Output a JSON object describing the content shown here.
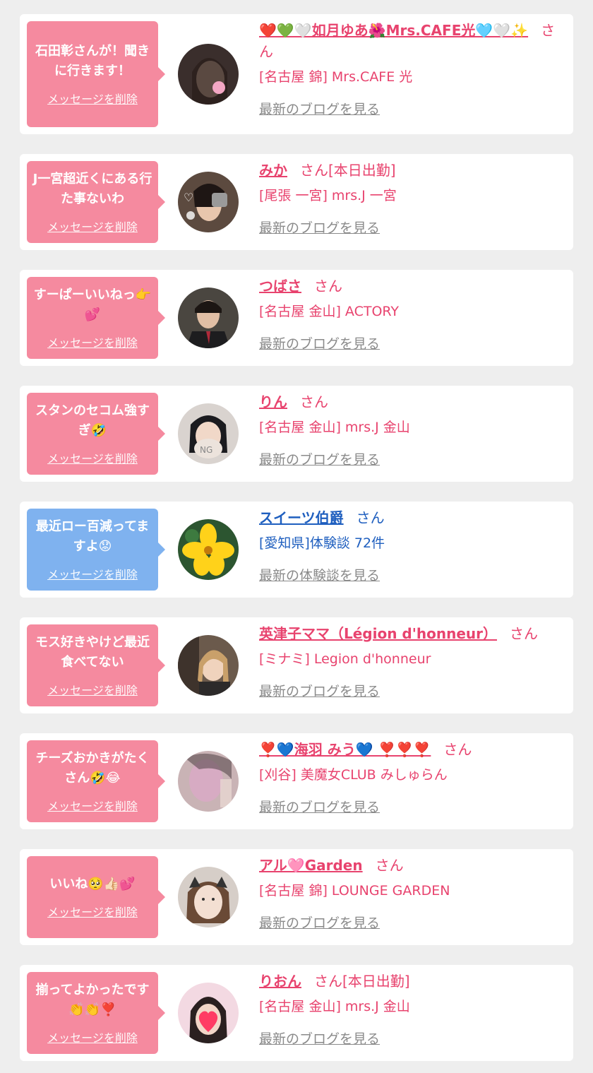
{
  "delete_label": "メッセージを削除",
  "colors": {
    "pink": "#f58a9f",
    "blue": "#7fb2ef",
    "name_pink": "#e8436e",
    "name_blue": "#1f5fbf"
  },
  "entries": [
    {
      "message": "石田彰さんが！聞きに行きます！",
      "name": "❤️💚🤍如月ゆあ🌺Mrs.CAFE光🩵🤍✨",
      "san": "さん",
      "shop": "[名古屋 錦] Mrs.CAFE 光",
      "link": "最新のブログを見る",
      "color": "pink",
      "avatar": "avatar-dark-hair"
    },
    {
      "message": "J一宮超近くにある行た事ないわ",
      "name": "みか",
      "san": "さん[本日出勤]",
      "shop": "[尾張 一宮] mrs.J 一宮",
      "link": "最新のブログを見る",
      "color": "pink",
      "avatar": "avatar-cat-stickers"
    },
    {
      "message": "すーぱーいいねっ👉💕",
      "name": "つばさ",
      "san": "さん",
      "shop": "[名古屋 金山] ACTORY",
      "link": "最新のブログを見る",
      "color": "pink",
      "avatar": "avatar-male-suit"
    },
    {
      "message": "スタンのセコム強すぎ🤣",
      "name": "りん",
      "san": "さん",
      "shop": "[名古屋 金山] mrs.J 金山",
      "link": "最新のブログを見る",
      "color": "pink",
      "avatar": "avatar-ng-mask"
    },
    {
      "message": "最近ロー百減ってますよ😟",
      "name": "スイーツ伯爵",
      "san": "さん",
      "shop": "[愛知県]体験談 72件",
      "link": "最新の体験談を見る",
      "color": "blue",
      "avatar": "avatar-yellow-flower"
    },
    {
      "message": "モス好きやけど最近食べてない",
      "name": "英津子ママ（Légion d'honneur）",
      "san": "さん",
      "shop": "[ミナミ] Legion d'honneur",
      "link": "最新のブログを見る",
      "color": "pink",
      "avatar": "avatar-blonde"
    },
    {
      "message": "チーズおかきがたくさん🤣😂",
      "name": "❣️💙海羽 みう💙 ❣️❣️❣️",
      "san": "さん",
      "shop": "[刈谷] 美魔女CLUB みしゅらん",
      "link": "最新のブログを見る",
      "color": "pink",
      "avatar": "avatar-blurred"
    },
    {
      "message": "いいね🥺👍🏻💕",
      "name": "アル🩷Garden",
      "san": "さん",
      "shop": "[名古屋 錦] LOUNGE GARDEN",
      "link": "最新のブログを見る",
      "color": "pink",
      "avatar": "avatar-cat-ears"
    },
    {
      "message": "揃ってよかったです👏👏❣️",
      "name": "りおん",
      "san": "さん[本日出勤]",
      "shop": "[名古屋 金山] mrs.J 金山",
      "link": "最新のブログを見る",
      "color": "pink",
      "avatar": "avatar-heart-face"
    }
  ]
}
